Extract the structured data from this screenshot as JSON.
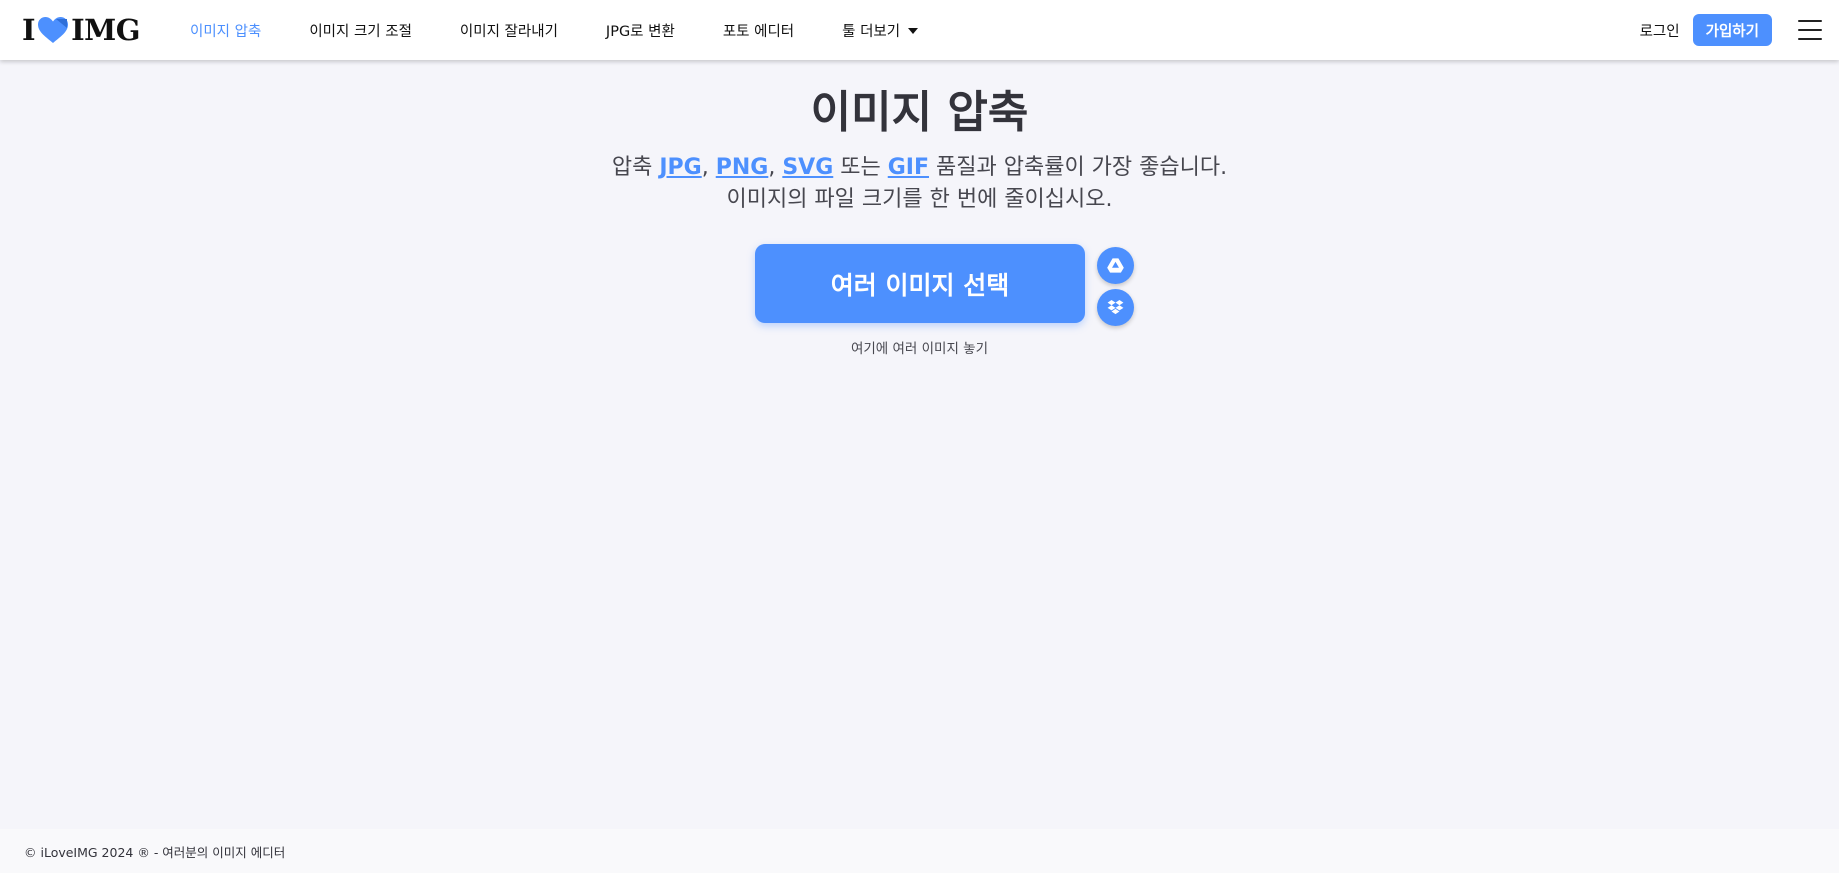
{
  "header": {
    "logo": {
      "left": "I",
      "right": "IMG"
    },
    "nav": [
      {
        "label": "이미지 압축",
        "active": true
      },
      {
        "label": "이미지 크기 조절"
      },
      {
        "label": "이미지 잘라내기"
      },
      {
        "label": "JPG로 변환"
      },
      {
        "label": "포토 에디터"
      },
      {
        "label": "툴 더보기",
        "dropdown": true
      }
    ],
    "login_label": "로그인",
    "signup_label": "가입하기"
  },
  "main": {
    "title": "이미지 압축",
    "subtitle": {
      "prefix": "압축 ",
      "format1": "JPG",
      "sep1": ", ",
      "format2": "PNG",
      "sep2": ", ",
      "format3": "SVG",
      "sep3": " 또는 ",
      "format4": "GIF",
      "suffix": " 품질과 압축률이 가장 좋습니다.",
      "line2": "이미지의 파일 크기를 한 번에 줄이십시오."
    },
    "select_button_label": "여러 이미지 선택",
    "drop_hint": "여기에 여러 이미지 놓기",
    "cloud_buttons": [
      "google-drive-icon",
      "dropbox-icon"
    ]
  },
  "footer": {
    "text": "© iLoveIMG 2024 ® - 여러분의 이미지 에디터"
  },
  "colors": {
    "accent": "#4d90fe",
    "background": "#f5f5fa",
    "text": "#33333b"
  }
}
